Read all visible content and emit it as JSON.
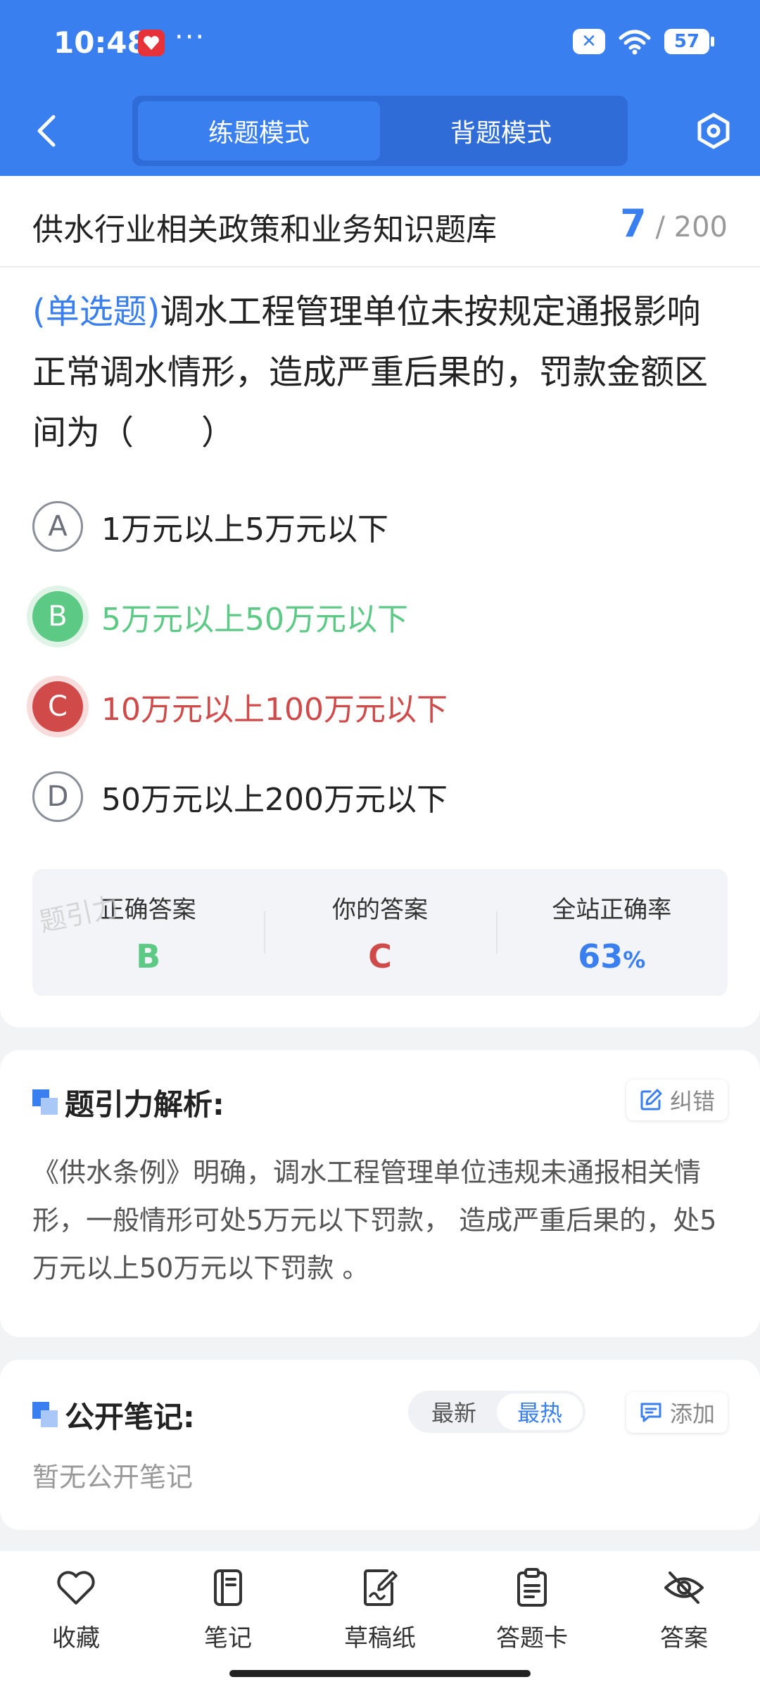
{
  "status_bar": {
    "time": "10:48",
    "dots": "···",
    "x_icon": "✕",
    "battery": "57"
  },
  "header": {
    "tabs": [
      "练题模式",
      "背题模式"
    ],
    "active_tab": 0
  },
  "bank": {
    "title": "供水行业相关政策和业务知识题库",
    "current": "7",
    "total": "/ 200"
  },
  "question": {
    "type": "(单选题)",
    "text": "调水工程管理单位未按规定通报影响正常调水情形，造成严重后果的，罚款金额区间为（　　）"
  },
  "options": [
    {
      "letter": "A",
      "text": "1万元以上5万元以下",
      "state": "normal"
    },
    {
      "letter": "B",
      "text": "5万元以上50万元以下",
      "state": "correct"
    },
    {
      "letter": "C",
      "text": "10万元以上100万元以下",
      "state": "wrong"
    },
    {
      "letter": "D",
      "text": "50万元以上200万元以下",
      "state": "normal"
    }
  ],
  "stats": {
    "correct_label": "正确答案",
    "correct_value": "B",
    "yours_label": "你的答案",
    "yours_value": "C",
    "rate_label": "全站正确率",
    "rate_value": "63",
    "rate_unit": "%"
  },
  "watermark": "题引力",
  "analysis": {
    "title": "题引力解析:",
    "report_label": "纠错",
    "text": "《供水条例》明确，调水工程管理单位违规未通报相关情形，一般情形可处5万元以下罚款， 造成严重后果的，处5万元以上50万元以下罚款 。"
  },
  "notes": {
    "title": "公开笔记:",
    "sort_options": [
      "最新",
      "最热"
    ],
    "active_sort": 1,
    "add_label": "添加",
    "empty_text": "暂无公开笔记"
  },
  "bottom_nav": [
    "收藏",
    "笔记",
    "草稿纸",
    "答题卡",
    "答案"
  ],
  "colors": {
    "primary": "#3a7ff0",
    "correct": "#5cc985",
    "wrong": "#cf4a48"
  }
}
